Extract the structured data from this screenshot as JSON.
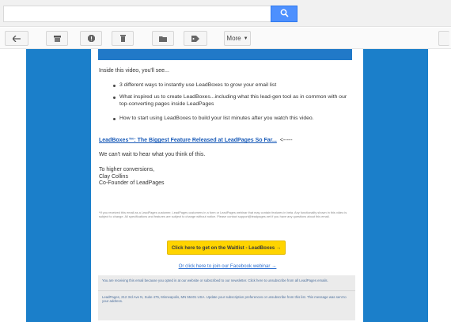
{
  "search": {
    "value": "",
    "placeholder": ""
  },
  "toolbar": {
    "more_label": "More",
    "icons": [
      "back-arrow-icon",
      "archive-icon",
      "report-spam-icon",
      "trash-icon",
      "folder-icon",
      "label-tag-icon",
      "chevron-down-icon"
    ]
  },
  "email": {
    "intro": "Inside this video, you'll see...",
    "bullets": [
      "3 different ways to instantly use LeadBoxes to grow your email list",
      "What inspired us to create LeadBoxes...including what this lead-gen tool as in common with our top-converting pages inside LeadPages",
      "How to start using LeadBoxes to build your list minutes after you watch this video."
    ],
    "video_link": "LeadBoxes™: The Biggest Feature Released at LeadPages So Far...",
    "video_link_suffix": "<-----",
    "wait_text": "We can't wait to hear what you think of this.",
    "signoff": "To higher conversions,",
    "sender_name": "Clay Collins",
    "sender_title": "Co-Founder of LeadPages",
    "fineprint": "*If you received this email as a LeadPages customer, LeadPages customers in a form or LeadPages webinar that may contain features in beta. Any functionality shown in this video is subject to change. All specifications and features are subject to change without notice. Please contact support@leadpages.net if you have any questions about this email.",
    "cta_button": "Click here to get on the Waitlist - LeadBoxes →",
    "alt_cta": "Or click here to join our Facebook webinar →",
    "footer_text_1": "You are receiving this email because you opted in at our website or subscribed to our newsletter. Click here to unsubscribe from all LeadPages emails.",
    "footer_text_2": "LeadPages, 212 3rd Ave N, Suite 475, Minneapolis, MN 55401 USA. Update your subscription preferences or unsubscribe from this list. This message was sent to your address."
  },
  "colors": {
    "brand_blue": "#1b7fca",
    "header_blue": "#2179c8",
    "search_button": "#4d90fe",
    "cta_yellow": "#ffd400",
    "link_blue": "#1a5bb8"
  }
}
